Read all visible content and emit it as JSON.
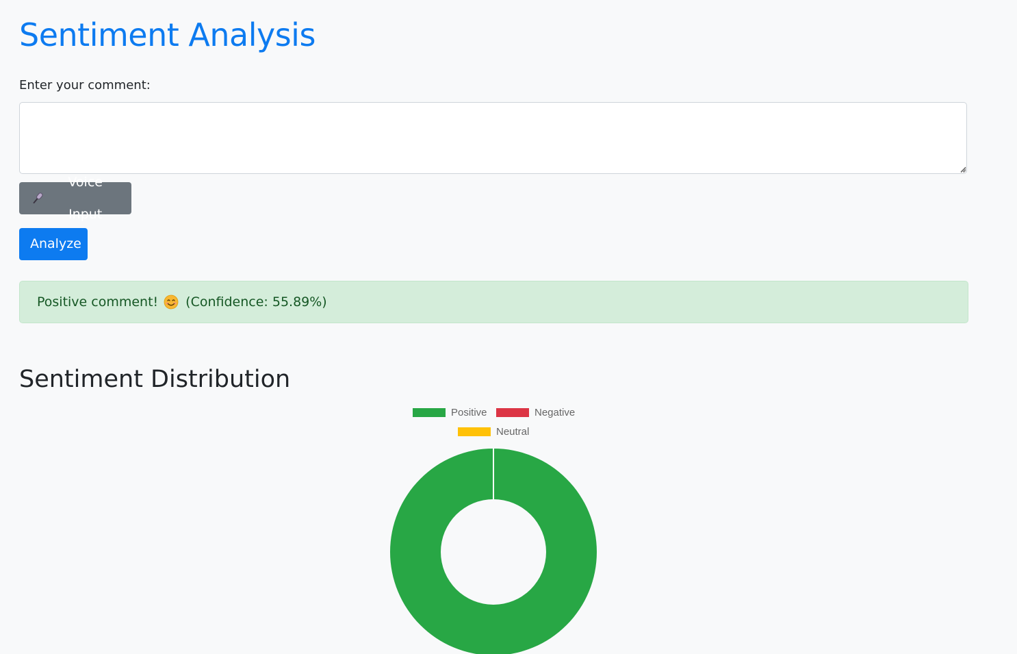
{
  "header": {
    "title": "Sentiment Analysis"
  },
  "form": {
    "comment_label": "Enter your comment:",
    "comment_value": "",
    "voice_button_label": "Voice Input",
    "voice_icon": "microphone-icon",
    "analyze_button_label": "Analyze"
  },
  "result": {
    "message": "Positive comment!",
    "emoji_icon": "smiling-face-icon",
    "confidence_text": "(Confidence: 55.89%)",
    "status_color": "#155724"
  },
  "distribution": {
    "section_title": "Sentiment Distribution"
  },
  "chart_data": {
    "type": "pie",
    "title": "",
    "categories": [
      "Positive",
      "Negative",
      "Neutral"
    ],
    "values": [
      1,
      0,
      0
    ],
    "colors": [
      "#28a745",
      "#dc3545",
      "#ffc107"
    ],
    "legend_position": "top",
    "donut": true
  },
  "colors": {
    "accent": "#0d7bf0",
    "secondary": "#6c757d",
    "alert_bg": "#d4edda"
  }
}
